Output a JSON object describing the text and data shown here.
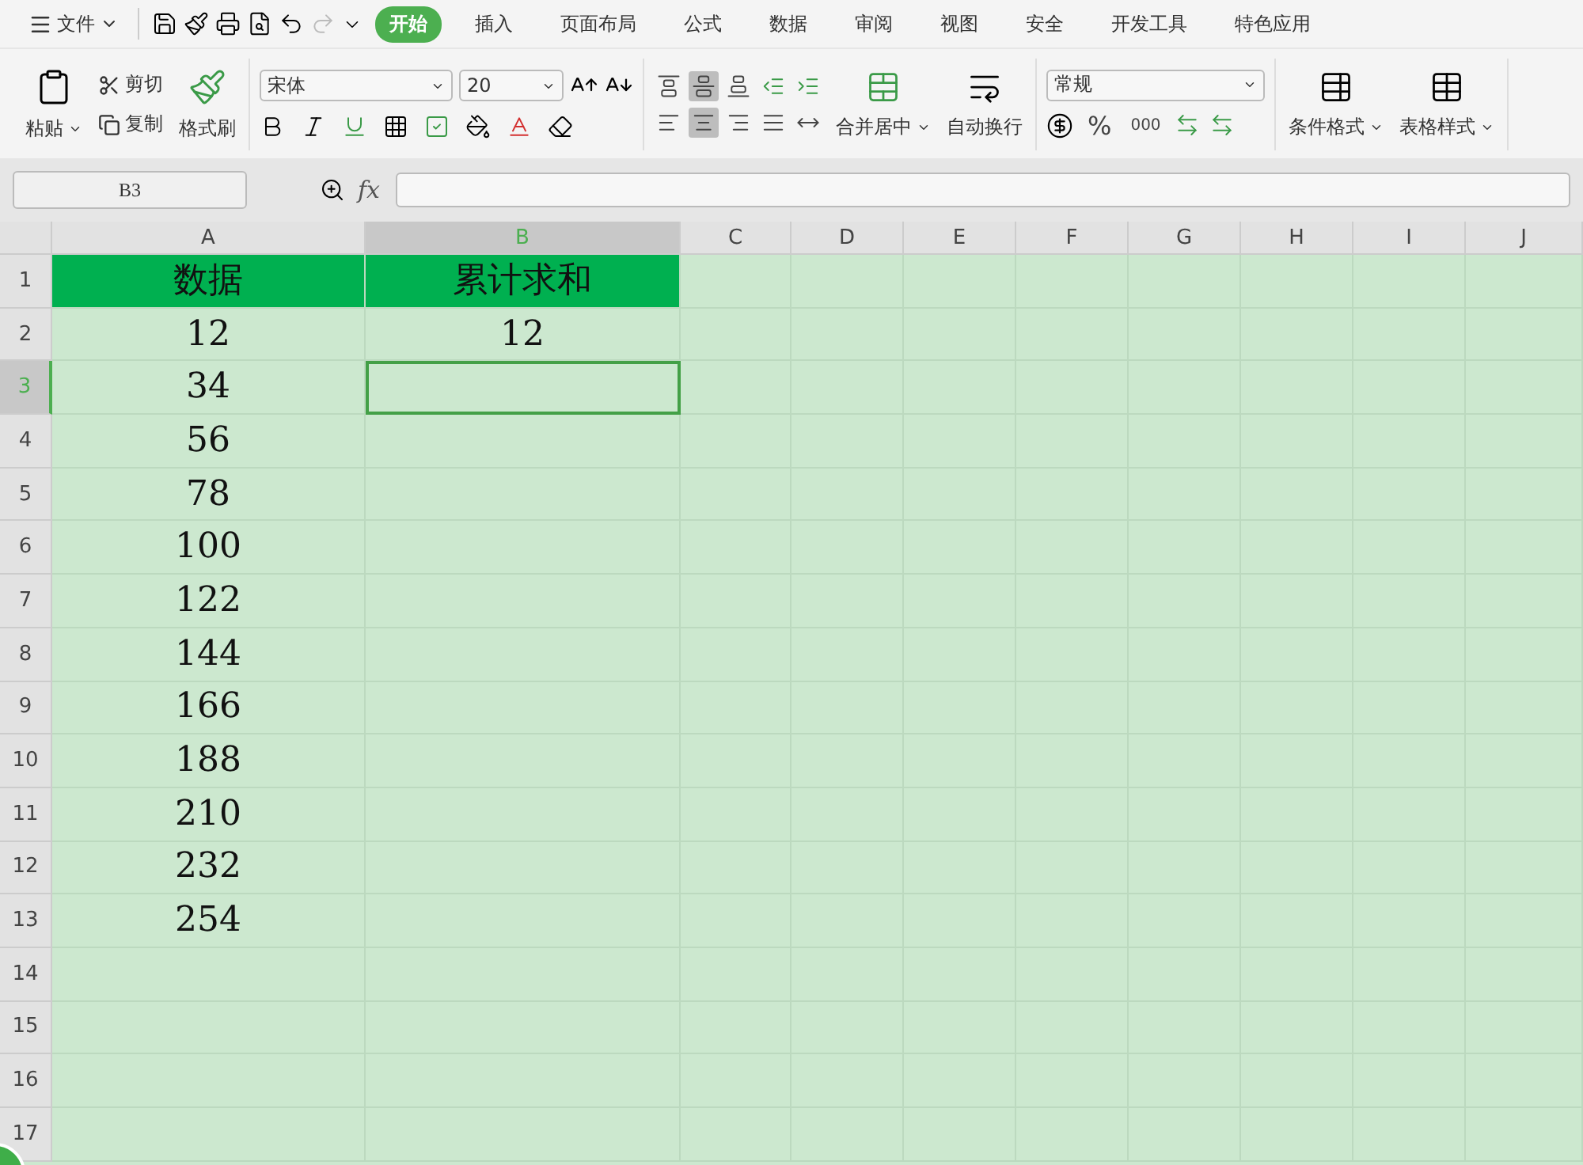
{
  "menu": {
    "file_label": "文件",
    "tabs": [
      {
        "label": "开始",
        "selected": true
      },
      {
        "label": "插入",
        "selected": false
      },
      {
        "label": "页面布局",
        "selected": false
      },
      {
        "label": "公式",
        "selected": false
      },
      {
        "label": "数据",
        "selected": false
      },
      {
        "label": "审阅",
        "selected": false
      },
      {
        "label": "视图",
        "selected": false
      },
      {
        "label": "安全",
        "selected": false
      },
      {
        "label": "开发工具",
        "selected": false
      },
      {
        "label": "特色应用",
        "selected": false
      }
    ]
  },
  "ribbon": {
    "paste": "粘贴",
    "cut": "剪切",
    "copy": "复制",
    "format_painter": "格式刷",
    "font_name": "宋体",
    "font_size": "20",
    "merge_center": "合并居中",
    "wrap_text": "自动换行",
    "number_format": "常规",
    "percent": "%",
    "thousands": "000",
    "conditional_format": "条件格式",
    "table_style": "表格样式",
    "align_buttons": [
      {
        "kind": "top",
        "selected": false
      },
      {
        "kind": "middle",
        "selected": true
      },
      {
        "kind": "bottom",
        "selected": false
      },
      {
        "kind": "outdent",
        "selected": false
      },
      {
        "kind": "indent",
        "selected": false
      },
      {
        "kind": "left",
        "selected": false
      },
      {
        "kind": "center",
        "selected": true
      },
      {
        "kind": "right",
        "selected": false
      },
      {
        "kind": "justify",
        "selected": false
      },
      {
        "kind": "distribute",
        "selected": false
      }
    ]
  },
  "formula_bar": {
    "name_box": "B3",
    "fx_label": "fx"
  },
  "grid": {
    "columns": [
      {
        "label": "A",
        "selected": false
      },
      {
        "label": "B",
        "selected": true
      },
      {
        "label": "C",
        "selected": false
      },
      {
        "label": "D",
        "selected": false
      },
      {
        "label": "E",
        "selected": false
      },
      {
        "label": "F",
        "selected": false
      },
      {
        "label": "G",
        "selected": false
      },
      {
        "label": "H",
        "selected": false
      },
      {
        "label": "I",
        "selected": false
      },
      {
        "label": "J",
        "selected": false
      }
    ],
    "rows": [
      {
        "label": "1",
        "kind": "header",
        "selected": false,
        "cells": [
          {
            "text": "数据",
            "selected": false
          },
          {
            "text": "累计求和",
            "selected": false
          }
        ]
      },
      {
        "label": "2",
        "kind": "data",
        "selected": false,
        "cells": [
          {
            "text": "12",
            "selected": false
          },
          {
            "text": "12",
            "selected": false
          }
        ]
      },
      {
        "label": "3",
        "kind": "data",
        "selected": true,
        "cells": [
          {
            "text": "34",
            "selected": false
          },
          {
            "selected": true
          }
        ]
      },
      {
        "label": "4",
        "kind": "data",
        "selected": false,
        "cells": [
          {
            "text": "56",
            "selected": false
          },
          {
            "selected": false
          }
        ]
      },
      {
        "label": "5",
        "kind": "data",
        "selected": false,
        "cells": [
          {
            "text": "78",
            "selected": false
          },
          {
            "selected": false
          }
        ]
      },
      {
        "label": "6",
        "kind": "data",
        "selected": false,
        "cells": [
          {
            "text": "100",
            "selected": false
          },
          {
            "selected": false
          }
        ]
      },
      {
        "label": "7",
        "kind": "data",
        "selected": false,
        "cells": [
          {
            "text": "122",
            "selected": false
          },
          {
            "selected": false
          }
        ]
      },
      {
        "label": "8",
        "kind": "data",
        "selected": false,
        "cells": [
          {
            "text": "144",
            "selected": false
          },
          {
            "selected": false
          }
        ]
      },
      {
        "label": "9",
        "kind": "data",
        "selected": false,
        "cells": [
          {
            "text": "166",
            "selected": false
          },
          {
            "selected": false
          }
        ]
      },
      {
        "label": "10",
        "kind": "data",
        "selected": false,
        "cells": [
          {
            "text": "188",
            "selected": false
          },
          {
            "selected": false
          }
        ]
      },
      {
        "label": "11",
        "kind": "data",
        "selected": false,
        "cells": [
          {
            "text": "210",
            "selected": false
          },
          {
            "selected": false
          }
        ]
      },
      {
        "label": "12",
        "kind": "data",
        "selected": false,
        "cells": [
          {
            "text": "232",
            "selected": false
          },
          {
            "selected": false
          }
        ]
      },
      {
        "label": "13",
        "kind": "data",
        "selected": false,
        "cells": [
          {
            "text": "254",
            "selected": false
          },
          {
            "selected": false
          }
        ]
      },
      {
        "label": "14",
        "kind": "data",
        "selected": false,
        "cells": [
          {
            "selected": false
          },
          {
            "selected": false
          }
        ]
      },
      {
        "label": "15",
        "kind": "data",
        "selected": false,
        "cells": [
          {
            "selected": false
          },
          {
            "selected": false
          }
        ]
      },
      {
        "label": "16",
        "kind": "data",
        "selected": false,
        "cells": [
          {
            "selected": false
          },
          {
            "selected": false
          }
        ]
      },
      {
        "label": "17",
        "kind": "data",
        "selected": false,
        "cells": [
          {
            "selected": false
          },
          {
            "selected": false
          }
        ]
      }
    ]
  }
}
